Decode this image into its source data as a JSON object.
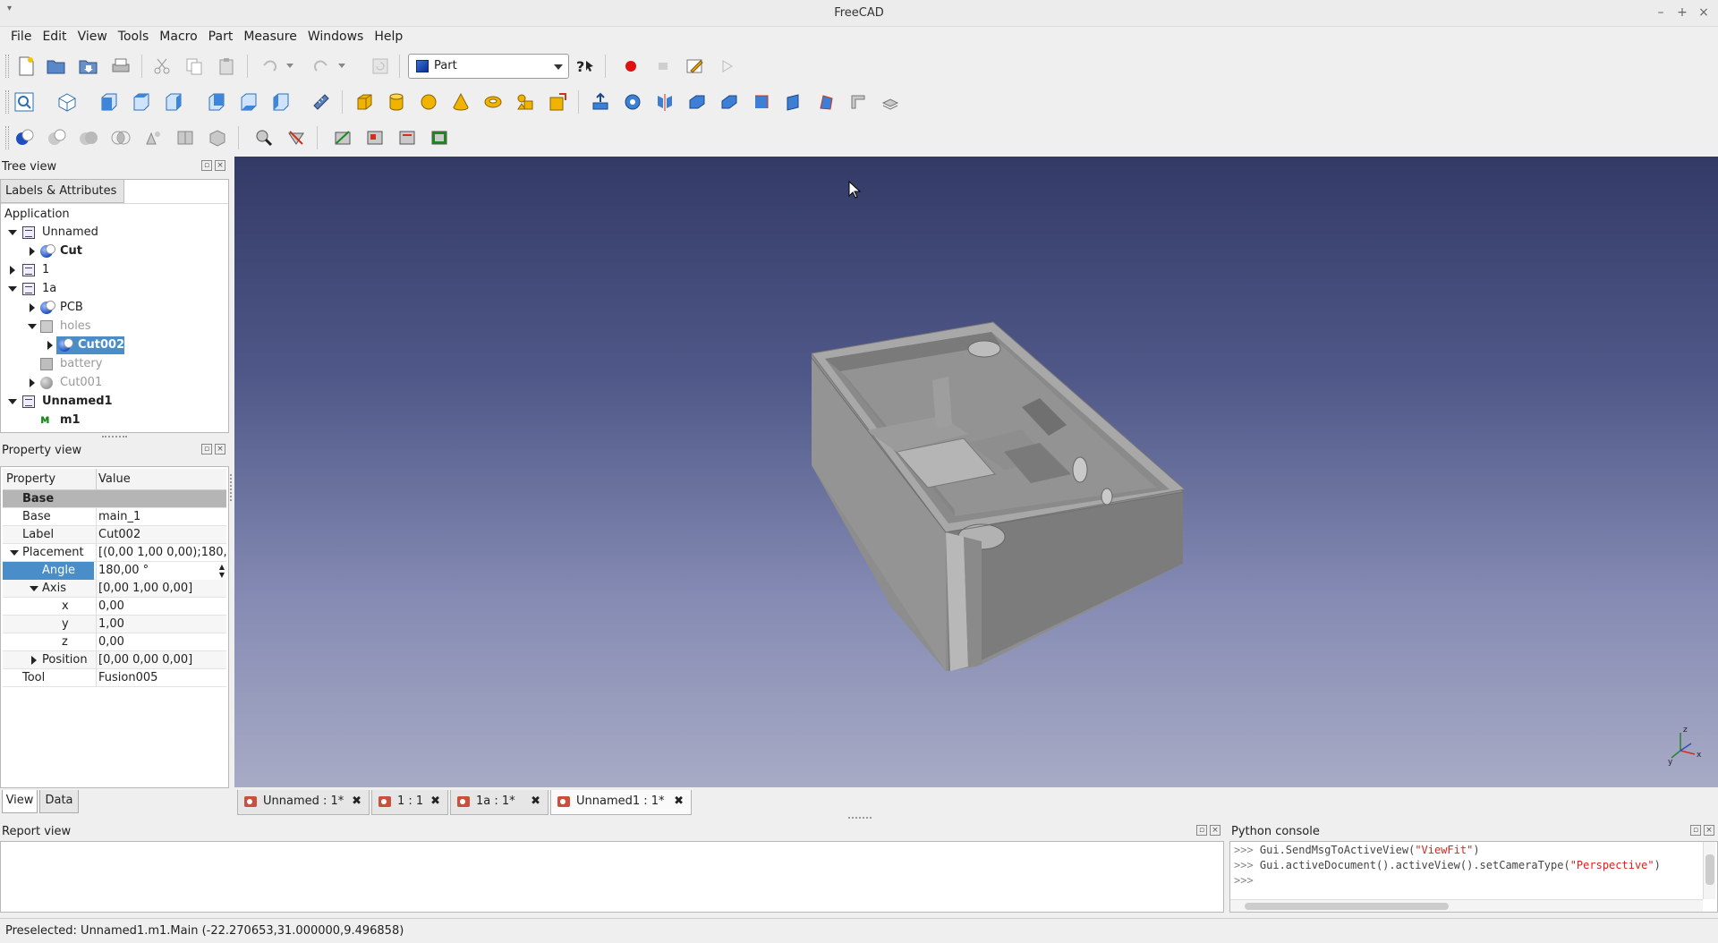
{
  "window": {
    "title": "FreeCAD",
    "minimize_glyph": "–",
    "maximize_glyph": "+",
    "close_glyph": "×",
    "sysmenu_glyph": "▾"
  },
  "menu": [
    "File",
    "Edit",
    "View",
    "Tools",
    "Macro",
    "Part",
    "Measure",
    "Windows",
    "Help"
  ],
  "toolbar": {
    "workbench": "Part"
  },
  "tree": {
    "title": "Tree view",
    "tab": "Labels & Attributes",
    "root": "Application",
    "items": [
      {
        "label": "Unnamed"
      },
      {
        "label": "Cut"
      },
      {
        "label": "1"
      },
      {
        "label": "1a"
      },
      {
        "label": "PCB"
      },
      {
        "label": "holes"
      },
      {
        "label": "Cut002"
      },
      {
        "label": "battery"
      },
      {
        "label": "Cut001"
      },
      {
        "label": "Unnamed1"
      },
      {
        "label": "m1"
      }
    ]
  },
  "property": {
    "title": "Property view",
    "col_property": "Property",
    "col_value": "Value",
    "group": "Base",
    "rows": [
      {
        "key": "Base",
        "value": "main_1"
      },
      {
        "key": "Label",
        "value": "Cut002"
      },
      {
        "key": "Placement",
        "value": "[(0,00 1,00 0,00);180,..."
      },
      {
        "key": "Angle",
        "value": "180,00 °"
      },
      {
        "key": "Axis",
        "value": "[0,00 1,00 0,00]"
      },
      {
        "key": "x",
        "value": "0,00"
      },
      {
        "key": "y",
        "value": "1,00"
      },
      {
        "key": "z",
        "value": "0,00"
      },
      {
        "key": "Position",
        "value": "[0,00 0,00 0,00]"
      },
      {
        "key": "Tool",
        "value": "Fusion005"
      }
    ],
    "tabs": [
      "View",
      "Data"
    ]
  },
  "doc_tabs": [
    {
      "label": "Unnamed : 1*"
    },
    {
      "label": "1 : 1"
    },
    {
      "label": "1a : 1*"
    },
    {
      "label": "Unnamed1 : 1*"
    }
  ],
  "report": {
    "title": "Report view"
  },
  "python": {
    "title": "Python console",
    "lines": [
      {
        "prompt": ">>>",
        "pre": " Gui.SendMsgToActiveView(",
        "str": "\"ViewFit\"",
        "post": ")"
      },
      {
        "prompt": ">>>",
        "pre": " Gui.activeDocument().activeView().setCameraType(",
        "str": "\"Perspective\"",
        "post": ")"
      },
      {
        "prompt": ">>>",
        "pre": "",
        "str": "",
        "post": ""
      }
    ]
  },
  "status": "Preselected: Unnamed1.m1.Main (-22.270653,31.000000,9.496858)",
  "axis": {
    "x": "x",
    "y": "y",
    "z": "z"
  }
}
